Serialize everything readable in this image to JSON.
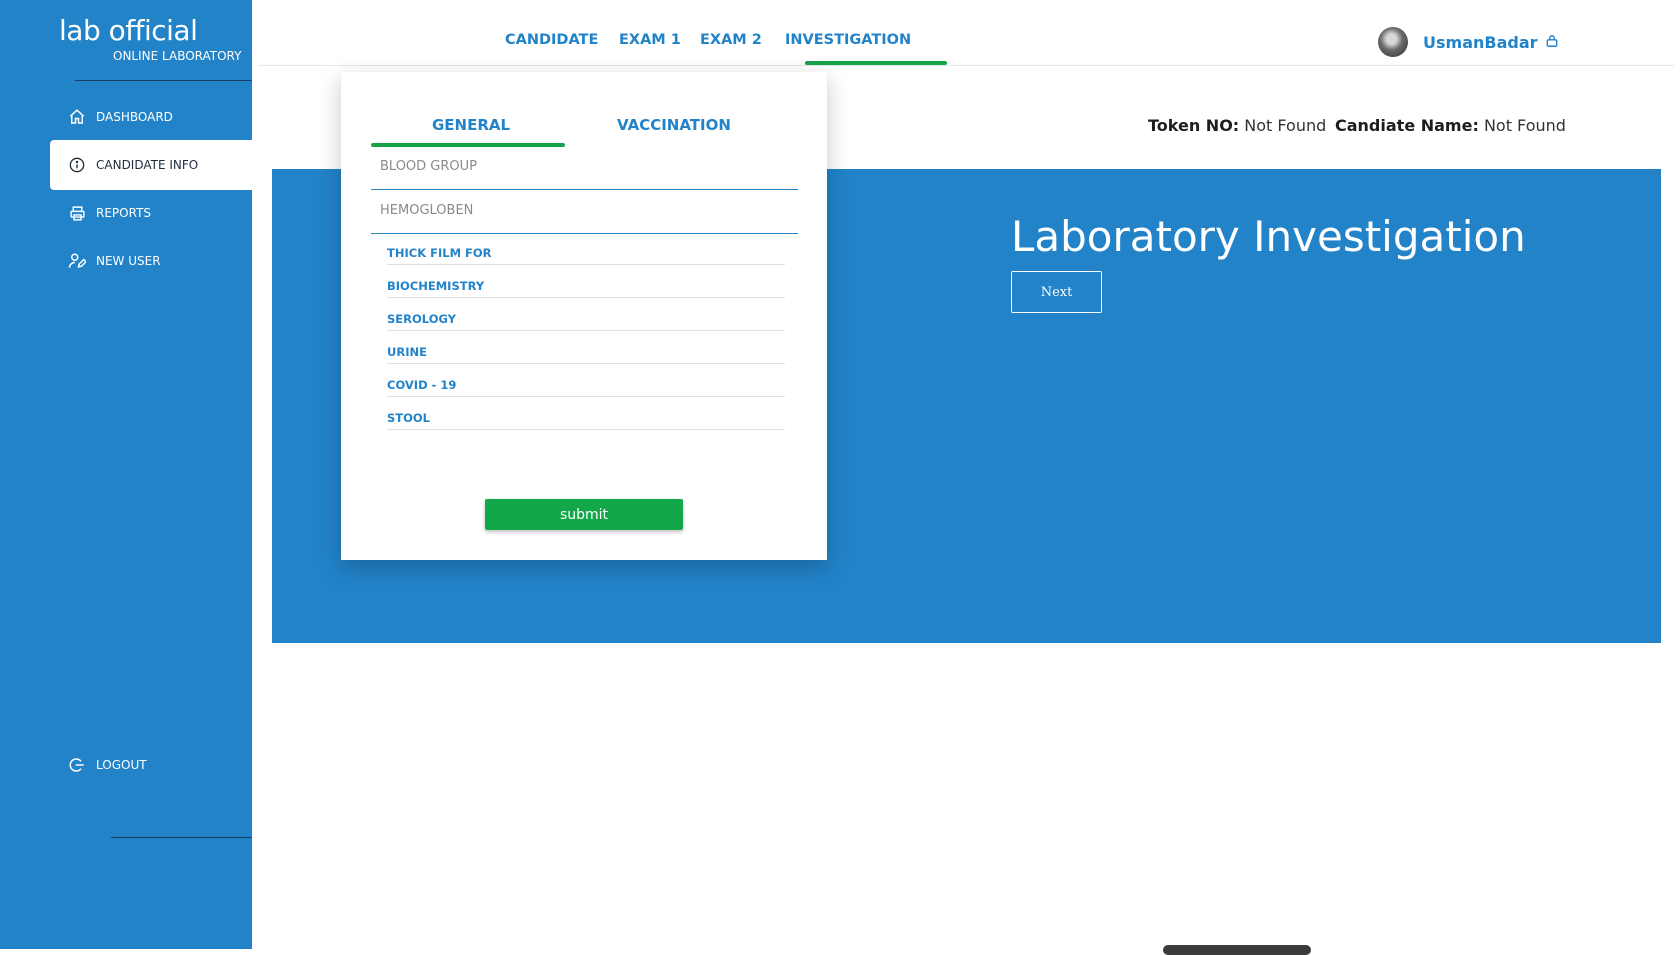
{
  "brand": {
    "title": "lab official",
    "subtitle": "ONLINE LABORATORY"
  },
  "sidebar": {
    "items": [
      {
        "label": "DASHBOARD",
        "icon": "home-icon"
      },
      {
        "label": "CANDIDATE INFO",
        "icon": "info-icon",
        "active": true
      },
      {
        "label": "REPORTS",
        "icon": "printer-icon"
      },
      {
        "label": "NEW USER",
        "icon": "user-edit-icon"
      }
    ],
    "logout": {
      "label": "LOGOUT",
      "icon": "logout-icon"
    }
  },
  "top_tabs": [
    {
      "label": "CANDIDATE"
    },
    {
      "label": "EXAM 1"
    },
    {
      "label": "EXAM 2"
    },
    {
      "label": "INVESTIGATION",
      "active": true
    }
  ],
  "user": {
    "name": "UsmanBadar",
    "icon": "lock-icon"
  },
  "token": {
    "label": "Token NO:",
    "value": "Not Found"
  },
  "candidate": {
    "label": "Candiate Name:",
    "value": "Not Found"
  },
  "hero": {
    "title": "Laboratory Investigation",
    "next_label": "Next"
  },
  "card": {
    "tabs": [
      {
        "label": "GENERAL",
        "active": true
      },
      {
        "label": "VACCINATION"
      }
    ],
    "fields": [
      {
        "placeholder": "BLOOD GROUP",
        "value": ""
      },
      {
        "placeholder": "HEMOGLOBEN",
        "value": ""
      }
    ],
    "links": [
      "THICK FILM FOR",
      "BIOCHEMISTRY",
      "SEROLOGY",
      "URINE",
      "COVID - 19",
      "STOOL"
    ],
    "submit_label": "submit"
  },
  "colors": {
    "primary": "#2283c9",
    "accent": "#17a34a",
    "submit": "#12a84a"
  }
}
